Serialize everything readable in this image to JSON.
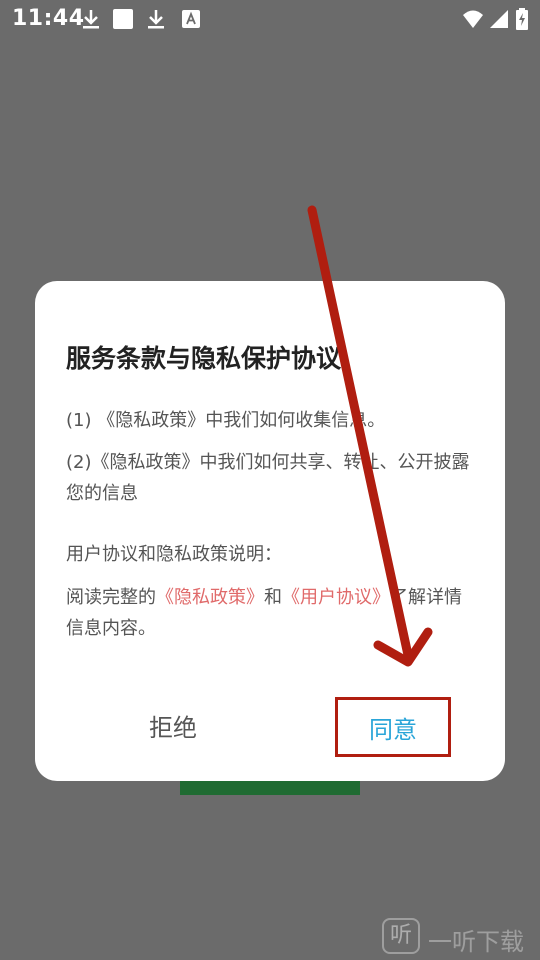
{
  "status_bar": {
    "time": "11:44",
    "icons": [
      "download-icon",
      "square-icon",
      "download-icon",
      "text-a-icon",
      "wifi-icon",
      "signal-icon",
      "battery-charging-icon"
    ]
  },
  "dialog": {
    "title": "服务条款与隐私保护协议",
    "item1": "(1) 《隐私政策》中我们如何收集信息。",
    "item2": "(2)《隐私政策》中我们如何共享、转让、公开披露您的信息",
    "section_heading": "用户协议和隐私政策说明：",
    "read_prefix": "阅读完整的",
    "privacy_link": "《隐私政策》",
    "and_text": "和",
    "user_link": "《用户协议》",
    "read_suffix": "了解详情信息内容。",
    "reject_label": "拒绝",
    "agree_label": "同意"
  },
  "watermark": {
    "logo_char": "听",
    "text": "一听下载"
  },
  "colors": {
    "overlay": "#6b6b6b",
    "link": "#e06a6a",
    "agree": "#2aa5d8",
    "annotation_red": "#b01e10"
  }
}
